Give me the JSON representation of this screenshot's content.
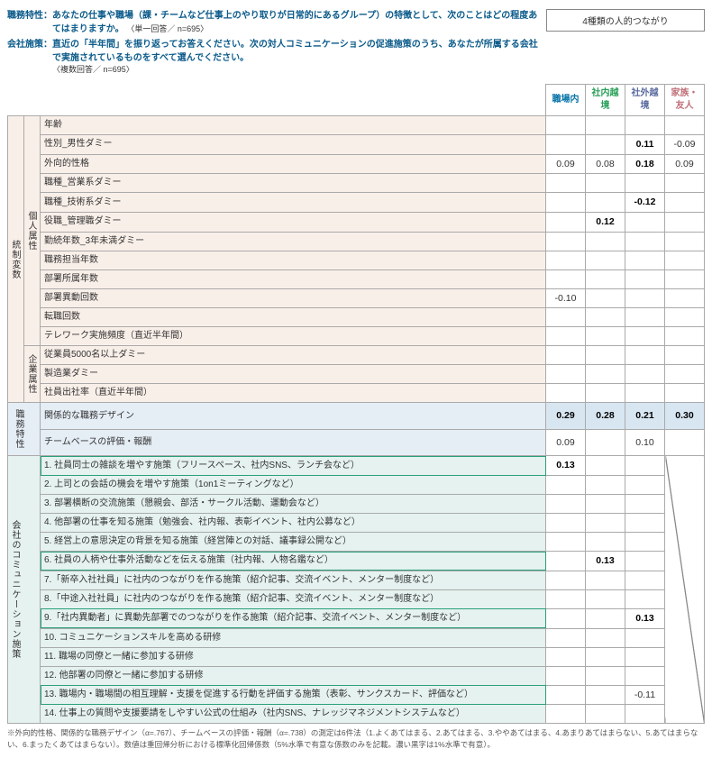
{
  "intro": {
    "q1_label": "職務特性：",
    "q1_text": "あなたの仕事や職場（課・チームなど仕事上のやり取りが日常的にあるグループ）の特徴として、次のことはどの程度あてはまりますか。",
    "q1_note": "〈単一回答／ n=695〉",
    "q2_label": "会社施策：",
    "q2_text": "直近の「半年間」を振り返ってお答えください。次の対人コミュニケーションの促進施策のうち、あなたが所属する会社で実施されているものをすべて選んでください。",
    "q2_note": "〈複数回答／ n=695〉"
  },
  "header": {
    "top": "4種類の人的つながり",
    "cols": [
      "職場内",
      "社内越境",
      "社外越境",
      "家族・友人"
    ]
  },
  "groups": {
    "g1": "統制変数",
    "g1a": "個人属性",
    "g1b": "企業属性",
    "g2": "職務特性",
    "g3": "会社のコミュニケーション施策"
  },
  "rows": {
    "personal": [
      {
        "label": "年齢",
        "v": [
          "",
          "",
          "",
          ""
        ]
      },
      {
        "label": "性別_男性ダミー",
        "v": [
          "",
          "",
          "0.11",
          "-0.09"
        ],
        "bold": [
          false,
          false,
          true,
          false
        ]
      },
      {
        "label": "外向的性格",
        "v": [
          "0.09",
          "0.08",
          "0.18",
          "0.09"
        ],
        "bold": [
          false,
          false,
          true,
          false
        ]
      },
      {
        "label": "職種_営業系ダミー",
        "v": [
          "",
          "",
          "",
          ""
        ]
      },
      {
        "label": "職種_技術系ダミー",
        "v": [
          "",
          "",
          "-0.12",
          ""
        ],
        "bold": [
          false,
          false,
          true,
          false
        ]
      },
      {
        "label": "役職_管理職ダミー",
        "v": [
          "",
          "0.12",
          "",
          ""
        ],
        "bold": [
          false,
          true,
          false,
          false
        ]
      },
      {
        "label": "勤続年数_3年未満ダミー",
        "v": [
          "",
          "",
          "",
          ""
        ]
      },
      {
        "label": "職務担当年数",
        "v": [
          "",
          "",
          "",
          ""
        ]
      },
      {
        "label": "部署所属年数",
        "v": [
          "",
          "",
          "",
          ""
        ]
      },
      {
        "label": "部署異動回数",
        "v": [
          "-0.10",
          "",
          "",
          ""
        ]
      },
      {
        "label": "転職回数",
        "v": [
          "",
          "",
          "",
          ""
        ]
      },
      {
        "label": "テレワーク実施頻度（直近半年間）",
        "v": [
          "",
          "",
          "",
          ""
        ]
      }
    ],
    "corp": [
      {
        "label": "従業員5000名以上ダミー",
        "v": [
          "",
          "",
          "",
          ""
        ]
      },
      {
        "label": "製造業ダミー",
        "v": [
          "",
          "",
          "",
          ""
        ]
      },
      {
        "label": "社員出社率（直近半年間）",
        "v": [
          "",
          "",
          "",
          ""
        ]
      }
    ],
    "job": [
      {
        "label": "関係的な職務デザイン",
        "v": [
          "0.29",
          "0.28",
          "0.21",
          "0.30"
        ],
        "bold": [
          true,
          true,
          true,
          true
        ],
        "hl": true
      },
      {
        "label": "チームベースの評価・報酬",
        "v": [
          "0.09",
          "",
          "0.10",
          ""
        ]
      }
    ],
    "comm": [
      {
        "label": "1. 社員同士の雑談を増やす施策（フリースペース、社内SNS、ランチ会など）",
        "v": [
          "0.13",
          "",
          "",
          ""
        ],
        "bold": [
          true,
          false,
          false,
          false
        ],
        "hl": true
      },
      {
        "label": "2. 上司との会話の機会を増やす施策（1on1ミーティングなど）",
        "v": [
          "",
          "",
          "",
          ""
        ]
      },
      {
        "label": "3. 部署横断の交流施策（懇親会、部活・サークル活動、運動会など）",
        "v": [
          "",
          "",
          "",
          ""
        ]
      },
      {
        "label": "4. 他部署の仕事を知る施策（勉強会、社内報、表彰イベント、社内公募など）",
        "v": [
          "",
          "",
          "",
          ""
        ]
      },
      {
        "label": "5. 経営上の意思決定の背景を知る施策（経営陣との対話、議事録公開など）",
        "v": [
          "",
          "",
          "",
          ""
        ]
      },
      {
        "label": "6. 社員の人柄や仕事外活動などを伝える施策（社内報、人物名鑑など）",
        "v": [
          "",
          "0.13",
          "",
          ""
        ],
        "bold": [
          false,
          true,
          false,
          false
        ],
        "hl": true
      },
      {
        "label": "7.「新卒入社社員」に社内のつながりを作る施策（紹介記事、交流イベント、メンター制度など）",
        "v": [
          "",
          "",
          "",
          ""
        ]
      },
      {
        "label": "8.「中途入社社員」に社内のつながりを作る施策（紹介記事、交流イベント、メンター制度など）",
        "v": [
          "",
          "",
          "",
          ""
        ]
      },
      {
        "label": "9.「社内異動者」に異動先部署でのつながりを作る施策（紹介記事、交流イベント、メンター制度など）",
        "v": [
          "",
          "",
          "0.13",
          ""
        ],
        "bold": [
          false,
          false,
          true,
          false
        ],
        "hl": true
      },
      {
        "label": "10. コミュニケーションスキルを高める研修",
        "v": [
          "",
          "",
          "",
          ""
        ]
      },
      {
        "label": "11. 職場の同僚と一緒に参加する研修",
        "v": [
          "",
          "",
          "",
          ""
        ]
      },
      {
        "label": "12. 他部署の同僚と一緒に参加する研修",
        "v": [
          "",
          "",
          "",
          ""
        ]
      },
      {
        "label": "13. 職場内・職場間の相互理解・支援を促進する行動を評価する施策（表彰、サンクスカード、評価など）",
        "v": [
          "",
          "",
          "-0.11",
          ""
        ],
        "hl": true
      },
      {
        "label": "14. 仕事上の質問や支援要請をしやすい公式の仕組み（社内SNS、ナレッジマネジメントシステムなど）",
        "v": [
          "",
          "",
          "",
          ""
        ]
      }
    ]
  },
  "footnote": "※外向的性格、関係的な職務デザイン（α=.767）、チームベースの評価・報酬（α=.738）の測定は6件法（1.よくあてはまる、2.あてはまる、3.ややあてはまる、4.あまりあてはまらない、5.あてはまらない、6.まったくあてはまらない）。数値は重回帰分析における標準化回帰係数（5%水準で有意な係数のみを記載。濃い黒字は1%水準で有意）。"
}
